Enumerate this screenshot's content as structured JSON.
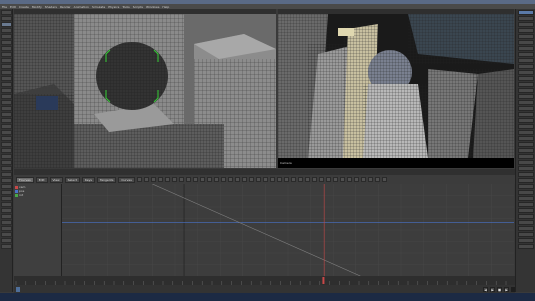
{
  "app": {
    "accent": "#5b7aa8",
    "keyframe_line_color": "#c84848",
    "curve_blue": "#4a72c8",
    "curve_gray": "#808080"
  },
  "menu": {
    "items": [
      "File",
      "Edit",
      "Create",
      "Modify",
      "Shaders",
      "Render",
      "Animation",
      "Simulate",
      "Physics",
      "Tools",
      "Scripts",
      "Windows",
      "Help"
    ]
  },
  "viewport_right": {
    "label": "Camera"
  },
  "anim": {
    "tabs": [
      "Fcurves",
      "Edit",
      "View",
      "Select",
      "Keys",
      "Tangents",
      "Curves"
    ],
    "selected_tab_index": 0
  },
  "curves": {
    "items": [
      {
        "label": "cam",
        "color": "#c84848"
      },
      {
        "label": "pos",
        "color": "#4a72c8"
      },
      {
        "label": "rot",
        "color": "#48a848"
      }
    ]
  },
  "status": {
    "field_text": "",
    "frame": "",
    "playhead_fraction": 0.58
  },
  "icons": {
    "play": "play-icon",
    "stop": "stop-icon",
    "next": "next-frame-icon",
    "prev": "prev-frame-icon"
  }
}
